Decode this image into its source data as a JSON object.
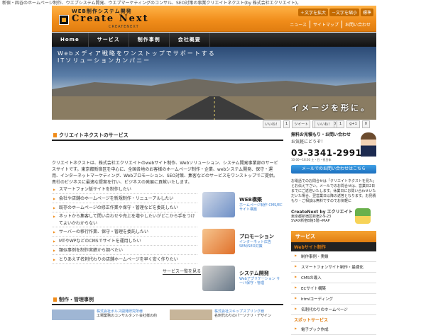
{
  "tagline": "新宿・四谷のホームページ制作、ウエブシステム開発、ウエブマーケティングのコンサル、SEO対策の事業クリエイトネクスト(by 株式会社エクリエイト)。",
  "header": {
    "logo_sub": "WEB制作システム開発",
    "logo_main": "Create Next",
    "logo_small": "CREATENEXT",
    "font_controls": [
      "＋文字を拡大",
      "－文字を縮小",
      "標準"
    ],
    "util_links": [
      "ニュース",
      "サイトマップ",
      "お問い合わせ"
    ]
  },
  "nav": [
    "Home",
    "サービス",
    "制作事例",
    "会社概要"
  ],
  "hero": {
    "line1": "Webメディア戦略をワンストップでサポートする",
    "line2": "ITソリューションカンパニー",
    "catch": "イメージを形に。"
  },
  "social": [
    "いいね！",
    "1",
    "ツイート",
    "0",
    "B!",
    "0"
  ],
  "social2": [
    "いいね！",
    "1",
    "g+1",
    "0"
  ],
  "main": {
    "section_title": "クリエイトネクストのサービス",
    "intro": "クリエイトネクストは、株式会社エクリエイトのwebサイト制作、Webソリューション、システム開発事業部のサービスサイトです。東京都新宿区を中心に、全国各地のお客様のホームページ制作・企業、webシステム開発、保守・運用、インターネットマーケティング、Webプロモーション、SEO対策、集客などのサービスをワンストップでご提供。貴社のビジネスに最適な提案を行い、ビジネスの発展に貢献いたします。",
    "services": [
      "スマートフォン版サイトを制作したい",
      "会社や店舗のホームページを新規制作・リニューアルしたい",
      "既存のホームページの修正作業や保守・管理などを委託したい",
      "ネットから集客して問い合わせや売上を増やしたいがどこから手をつけてよいかわからない",
      "サーバーの移行作業、保守・管理を委託したい",
      "MTやWPなどのCMSでサイトを運用したい",
      "類似事例を制作実績から調べたい",
      "とりあえず名刺代わりの店舗ホームページを早く安く作りたい"
    ],
    "services_more": "サービス一覧を見る",
    "pics": [
      {
        "title": "WEB構築",
        "sub": "ホームページ制作 CMS/ECサイト構築"
      },
      {
        "title": "プロモーション",
        "sub": "インターネット広告 SEM/SEO対策"
      },
      {
        "title": "システム開発",
        "sub": "Webアプリケーション サーバ保守・管理"
      }
    ],
    "works_title": "制作・管理事例",
    "works": [
      {
        "name": "株式会社ボルス開発研究所様",
        "desc": "工場業務のコンサルタント会社様の約"
      },
      {
        "name": "株式会社スキップスプリング様",
        "desc": "名刺代わりのパーソナリ・デザイン"
      }
    ]
  },
  "side": {
    "contact_title": "無料お見積もり・お問い合わせ",
    "contact_sub": "お気軽にどうぞ！",
    "tel": "03-3341-2991",
    "hours": "10:00〜18:30 土・日・祝日休",
    "mail_button": "メールでのお問い合わせはこちら",
    "note": "お電話でのお問合せは「クリエイトネクストを見た」とお伝え下さい。メールでのお問合せは、営業日2日までにご返信いたします。休業日にお問い合わせいただいた場合、翌営業日以降の返答となります。お見積もり・ご相談は無料ですのでお気軽に",
    "company_name": "CreateNext by エクリエイト",
    "company_addr1": "東京都新宿区新宿2-9-23",
    "company_addr2": "SVAX新宿B館5階→MAP",
    "menu_title": "サービス",
    "menu_sub1": "Webサイト制作",
    "menu_items1": [
      "制作事例・実績",
      "スマートフォンサイト制作・最適化",
      "CMSの導入",
      "ECサイト構築",
      "htmlコーディング",
      "名刺代わりのホームページ"
    ],
    "menu_sub2": "スポットサービス",
    "menu_items2": [
      "電子ブック作成"
    ]
  }
}
